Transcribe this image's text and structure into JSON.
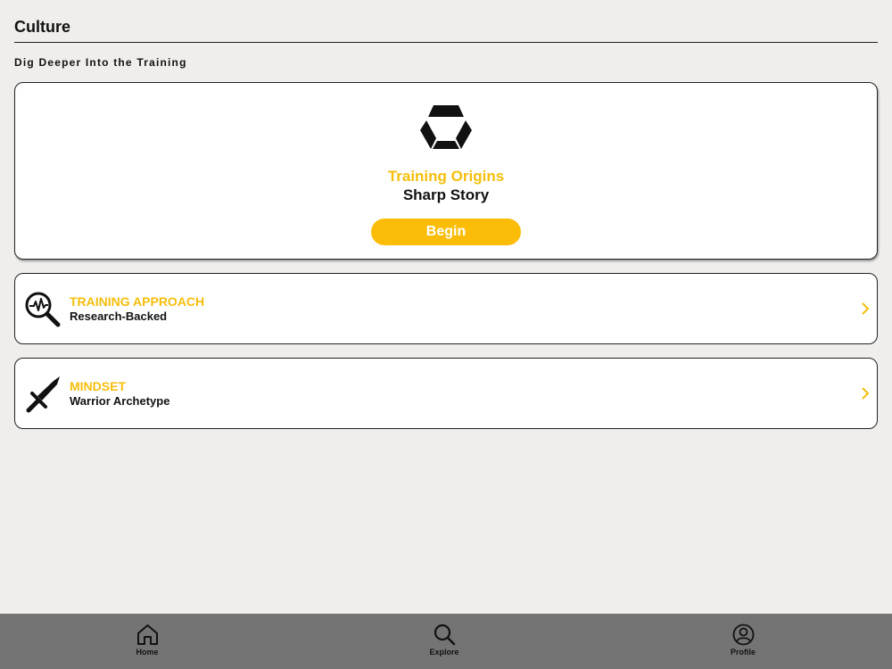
{
  "header": {
    "title": "Culture",
    "subtitle": "Dig Deeper Into the Training"
  },
  "hero": {
    "logo_icon": "hexagon-logo-icon",
    "heading": "Training Origins",
    "subheading": "Sharp Story",
    "button_label": "Begin"
  },
  "cards": [
    {
      "icon": "magnifier-pulse-icon",
      "title": "TRAINING APPROACH",
      "subtitle": "Research-Backed",
      "trailing_icon": "chevron-right-icon"
    },
    {
      "icon": "sword-icon",
      "title": "MINDSET",
      "subtitle": "Warrior Archetype",
      "trailing_icon": "chevron-right-icon"
    }
  ],
  "bottom_nav": {
    "items": [
      {
        "label": "Home",
        "icon": "home-icon"
      },
      {
        "label": "Explore",
        "icon": "search-icon"
      },
      {
        "label": "Profile",
        "icon": "profile-icon"
      }
    ]
  },
  "colors": {
    "accent": "#f5be0b",
    "button": "#fbbd08",
    "background": "#efeeec",
    "nav_background": "#747474",
    "card_background": "#ffffff"
  }
}
